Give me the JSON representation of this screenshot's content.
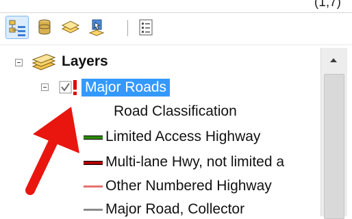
{
  "window": {
    "top_fragment": "(1,7)"
  },
  "toolbar": {
    "buttons": [
      {
        "icon": "list-by-drawing-order-icon",
        "active": true
      },
      {
        "icon": "list-by-source-icon",
        "active": false
      },
      {
        "icon": "list-by-visibility-icon",
        "active": false
      },
      {
        "icon": "list-by-selection-icon",
        "active": false
      },
      {
        "icon": "options-icon",
        "active": false
      }
    ]
  },
  "toc": {
    "root": {
      "label": "Layers",
      "icon": "layers-icon"
    },
    "layer": {
      "label": "Major Roads",
      "checked": true,
      "warning": true
    },
    "field_heading": "Road Classification",
    "legend": [
      {
        "label": "Limited Access Highway",
        "color": "#2e8b00",
        "outline": "#000000"
      },
      {
        "label": "Multi-lane Hwy, not limited a",
        "color": "#b30000",
        "outline": "#000000"
      },
      {
        "label": "Other Numbered Highway",
        "color": "#e56f6f"
      },
      {
        "label": "Major Road, Collector",
        "color": "#8a8a8a"
      }
    ]
  },
  "annotation": {
    "arrow_color": "#e8160e"
  }
}
